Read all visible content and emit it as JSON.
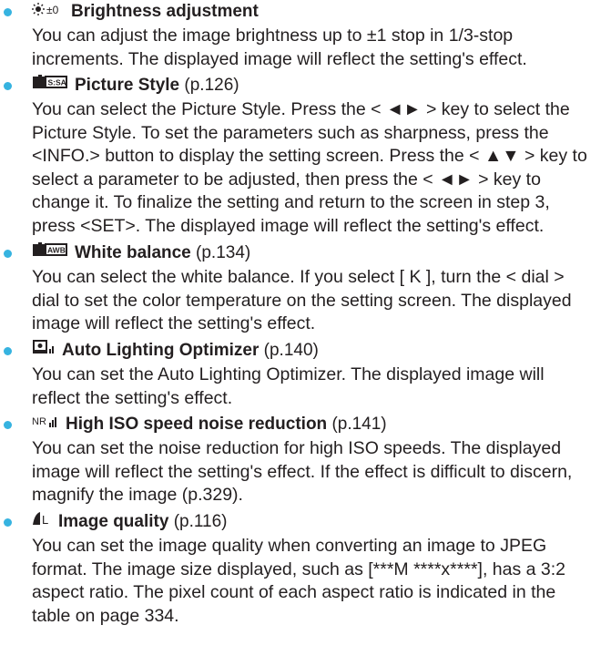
{
  "items": [
    {
      "icon": "brightness-icon",
      "icon_text": "☀±0",
      "title": "Brightness adjustment",
      "ref": "",
      "lines": [
        "You can adjust the image brightness up to ±1 stop in 1/3-stop",
        "increments. The displayed image will reflect the setting's effect."
      ]
    },
    {
      "icon": "picture-style-icon",
      "title": "Picture Style",
      "ref": "(p.126)",
      "lines": [
        "You can select the Picture Style. Press the < ◄► > key to select the",
        "Picture Style. To set the parameters such as sharpness, press the",
        "<INFO.> button to display the setting screen. Press the < ▲▼ > key to",
        "select a parameter to be adjusted, then press the < ◄► > key to",
        "change it. To finalize the setting and return to the screen in step 3,",
        "press <SET>. The displayed image will reflect the setting's effect."
      ]
    },
    {
      "icon": "white-balance-icon",
      "title": "White balance",
      "ref": "(p.134)",
      "lines": [
        "You can select the white balance. If you select [ K ], turn the < dial >",
        "dial to set the color temperature on the setting screen. The displayed",
        "image will reflect the setting's effect."
      ]
    },
    {
      "icon": "auto-lighting-optimizer-icon",
      "title": "Auto Lighting Optimizer",
      "ref": "(p.140)",
      "lines": [
        "You can set the Auto Lighting Optimizer. The displayed image will",
        "reflect the setting's effect."
      ]
    },
    {
      "icon": "noise-reduction-icon",
      "icon_text": "NR",
      "title": "High ISO speed noise reduction",
      "ref": "(p.141)",
      "lines": [
        "You can set the noise reduction for high ISO speeds. The displayed",
        "image will reflect the setting's effect. If the effect is difficult to discern,",
        "magnify the image (p.329)."
      ]
    },
    {
      "icon": "image-quality-icon",
      "icon_text": "L",
      "title": "Image quality",
      "ref": "(p.116)",
      "lines": [
        "You can set the image quality when converting an image to JPEG",
        "format. The image size displayed, such as [***M ****x****], has a 3:2",
        "aspect ratio. The pixel count of each aspect ratio is indicated in the",
        "table on page 334."
      ]
    }
  ],
  "glyphs": {
    "left_right": "◄►",
    "up_down": "▲▼",
    "info": "INFO.",
    "set": "SET",
    "kelvin": "K",
    "size_value": "***M",
    "size_dims": "****x****"
  },
  "colors": {
    "bullet": "#36b3e0",
    "text": "#231f20"
  }
}
